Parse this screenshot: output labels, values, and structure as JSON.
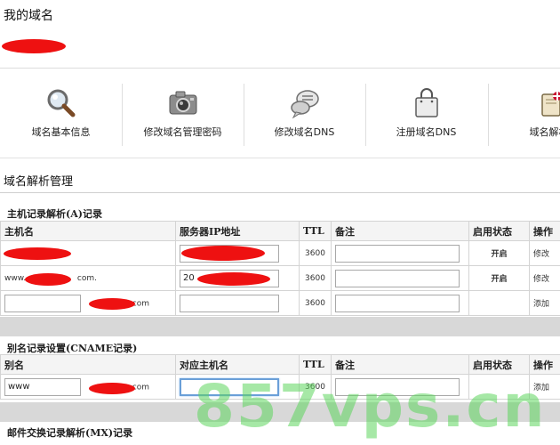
{
  "page": {
    "title": "我的域名"
  },
  "toolbar": {
    "items": [
      {
        "label": "域名基本信息",
        "icon": "magnifier-icon"
      },
      {
        "label": "修改域名管理密码",
        "icon": "camera-icon"
      },
      {
        "label": "修改域名DNS",
        "icon": "chat-bubble-icon"
      },
      {
        "label": "注册域名DNS",
        "icon": "bag-icon"
      },
      {
        "label": "域名解析",
        "icon": "book-flag-icon"
      }
    ]
  },
  "section": {
    "title": "域名解析管理"
  },
  "a_records": {
    "title": "主机记录解析(A)记录",
    "headers": {
      "host": "主机名",
      "ip": "服务器IP地址",
      "ttl": "TTL",
      "remark": "备注",
      "status": "启用状态",
      "op": "操作"
    },
    "rows": [
      {
        "host_prefix": "",
        "host_suffix": "",
        "ip": "",
        "ttl": "3600",
        "status": "开启",
        "op": "修改"
      },
      {
        "host_prefix": "www.",
        "host_suffix": "com.",
        "ip": "20",
        "ttl": "3600",
        "status": "开启",
        "op": "修改"
      },
      {
        "host_prefix": "",
        "host_suffix": "com",
        "ip": "",
        "ttl": "3600",
        "status": "",
        "op": "添加"
      }
    ]
  },
  "cname_records": {
    "title": "别名记录设置(CNAME记录)",
    "headers": {
      "alias": "别名",
      "target": "对应主机名",
      "ttl": "TTL",
      "remark": "备注",
      "status": "启用状态",
      "op": "操作"
    },
    "rows": [
      {
        "alias_value": "www",
        "alias_suffix": "com",
        "target": "",
        "ttl": "3600",
        "status": "",
        "op": "添加"
      }
    ]
  },
  "mx_records": {
    "title": "邮件交换记录解析(MX)记录"
  },
  "watermark": "857vps.cn",
  "colors": {
    "status": "#2c8a21",
    "op_link": "#e8911a",
    "redaction": "#ee1111"
  }
}
